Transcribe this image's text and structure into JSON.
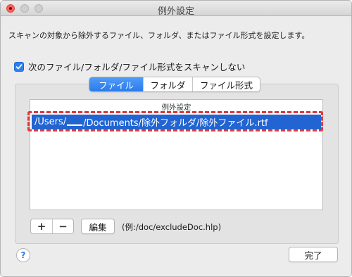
{
  "window": {
    "title": "例外設定"
  },
  "description": "スキャンの対象から除外するファイル、フォルダ、またはファイル形式を設定します。",
  "checkbox": {
    "label": "次のファイル/フォルダ/ファイル形式をスキャンしない",
    "checked": true
  },
  "tabs": [
    {
      "label": "ファイル",
      "active": true
    },
    {
      "label": "フォルダ",
      "active": false
    },
    {
      "label": "ファイル形式",
      "active": false
    }
  ],
  "list": {
    "header": "例外設定",
    "rows": [
      {
        "prefix": "/Users/",
        "suffix": "/Documents/除外フォルダ/除外ファイル.rtf",
        "selected": true
      }
    ]
  },
  "buttons": {
    "add": "+",
    "remove": "−",
    "edit": "編集",
    "example": "(例:/doc/excludeDoc.hlp)",
    "help": "?",
    "done": "完了"
  },
  "colors": {
    "accent": "#2b7bed",
    "selection": "#2164d2",
    "highlight_border": "#e03a3a",
    "close_button": "#fc605c"
  }
}
